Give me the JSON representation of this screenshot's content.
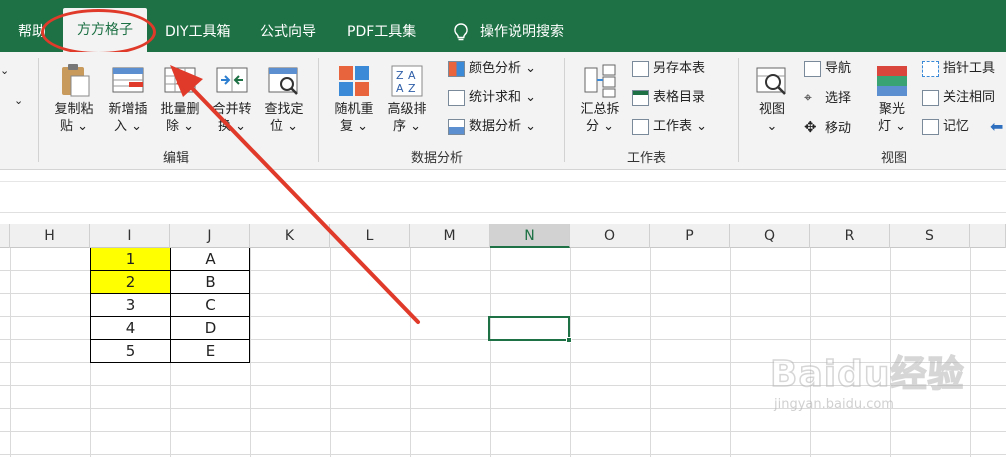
{
  "tabs": {
    "help": "帮助",
    "fangfang": "方方格子",
    "diy": "DIY工具箱",
    "formula": "公式向导",
    "pdf": "PDF工具集",
    "search": "操作说明搜索"
  },
  "ribbon": {
    "edit": {
      "copy_paste": [
        "复制粘",
        "贴"
      ],
      "add_insert": [
        "新增插",
        "入"
      ],
      "batch_delete": [
        "批量删",
        "除"
      ],
      "merge_convert": [
        "合并转",
        "换"
      ],
      "find_locate": [
        "查找定",
        "位"
      ],
      "label": "编辑"
    },
    "analysis": {
      "random_repeat": [
        "随机重",
        "复"
      ],
      "advanced_sort": [
        "高级排",
        "序"
      ],
      "color_analysis": "颜色分析",
      "stat_sum": "统计求和",
      "data_analysis": "数据分析",
      "label": "数据分析"
    },
    "sheet": {
      "summary_split": [
        "汇总拆",
        "分"
      ],
      "save_as": "另存本表",
      "sheet_dir": "表格目录",
      "worksheet": "工作表",
      "label": "工作表"
    },
    "view": {
      "view": "视图",
      "navigate": "导航",
      "select": "选择",
      "move": "移动",
      "spotlight": [
        "聚光",
        "灯"
      ],
      "pointer_tool": "指针工具",
      "focus_related": "关注相同",
      "memory": "记忆",
      "label": "视图"
    }
  },
  "columns": [
    "H",
    "I",
    "J",
    "K",
    "L",
    "M",
    "N",
    "O",
    "P",
    "Q",
    "R",
    "S"
  ],
  "table": [
    [
      "1",
      "A"
    ],
    [
      "2",
      "B"
    ],
    [
      "3",
      "C"
    ],
    [
      "4",
      "D"
    ],
    [
      "5",
      "E"
    ]
  ],
  "watermark": {
    "brand": "Baidu经验",
    "url": "jingyan.baidu.com"
  },
  "colors": {
    "excel_green": "#1e7145",
    "highlight_yellow": "#ffff00",
    "annotation_red": "#e03a2a"
  }
}
